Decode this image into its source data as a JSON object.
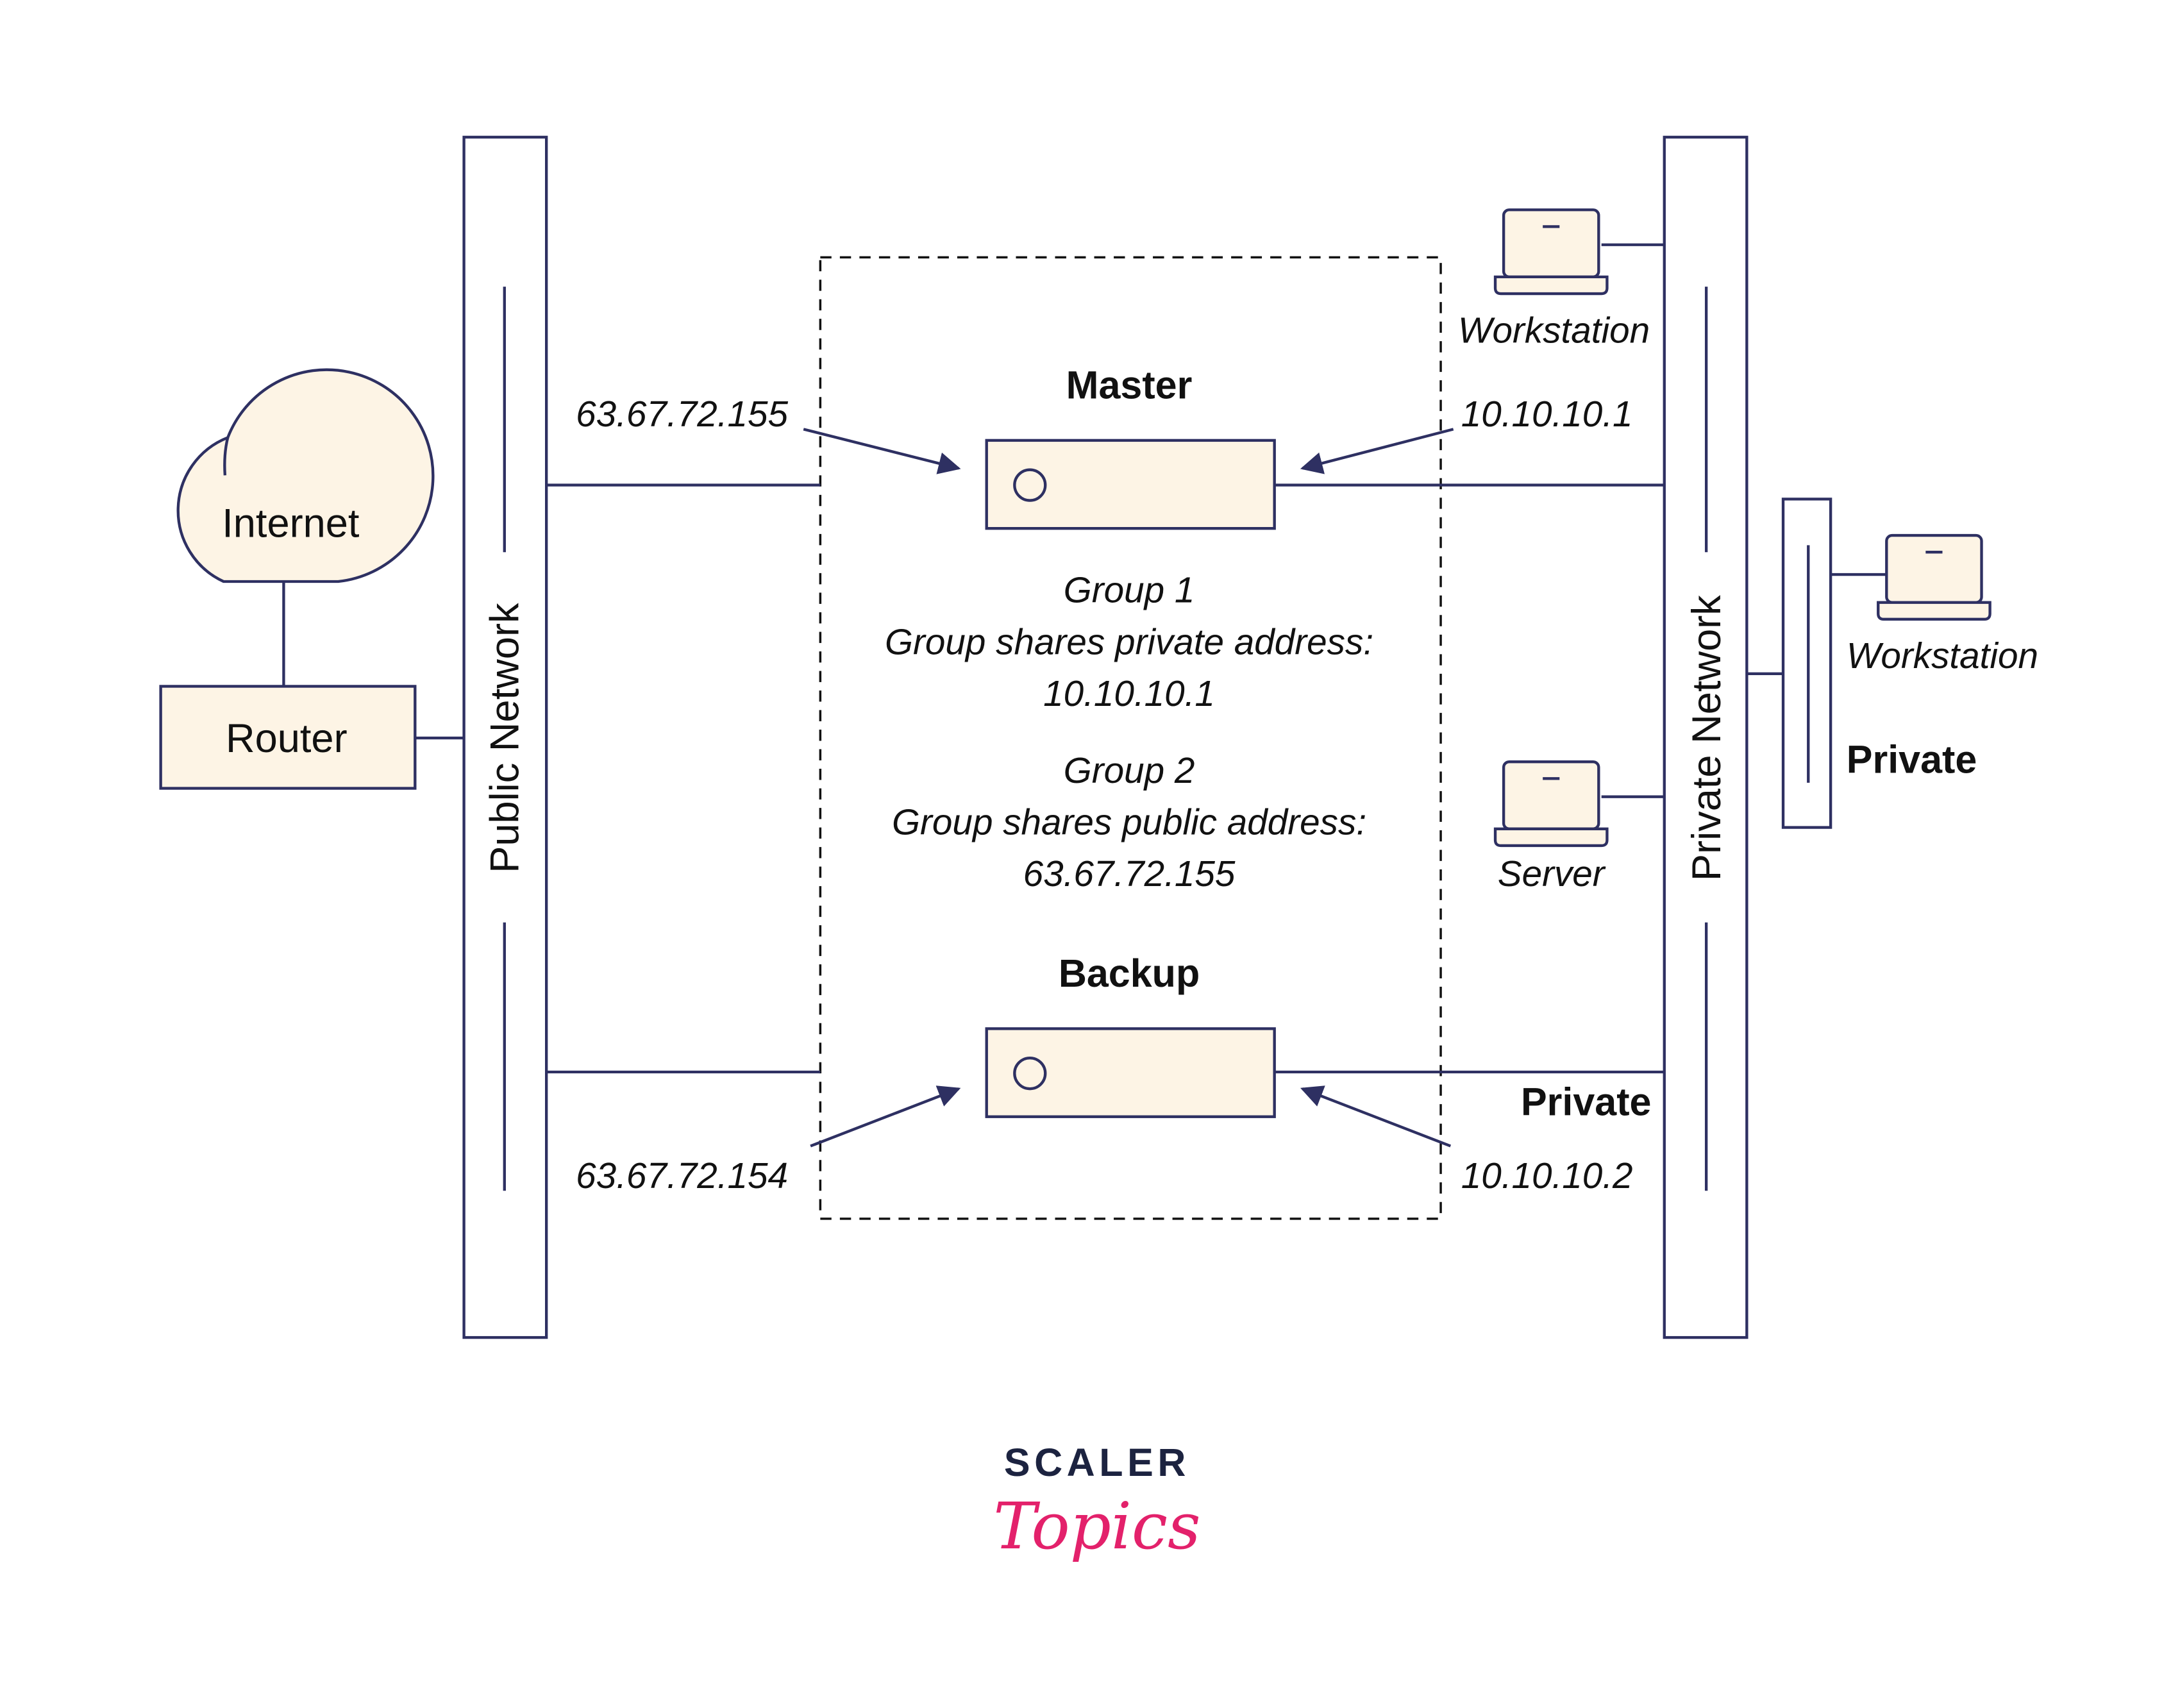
{
  "colors": {
    "stroke": "#2e3062",
    "fill": "#fdf4e5",
    "brand_pink": "#e3216b",
    "brand_dark": "#1c2340"
  },
  "nodes": {
    "internet": "Internet",
    "router": "Router",
    "public_network": "Public Network",
    "private_network": "Private Network",
    "master": "Master",
    "backup": "Backup",
    "workstation_1": "Workstation",
    "workstation_2": "Workstation",
    "server": "Server",
    "private_segment": "Private",
    "private_backup": "Private"
  },
  "addresses": {
    "master_public": "63.67.72.155",
    "master_private": "10.10.10.1",
    "backup_public": "63.67.72.154",
    "backup_private": "10.10.10.2"
  },
  "groups": {
    "g1_title": "Group 1",
    "g1_desc": "Group shares private address:",
    "g1_addr": "10.10.10.1",
    "g2_title": "Group 2",
    "g2_desc": "Group shares public address:",
    "g2_addr": "63.67.72.155"
  },
  "logo": {
    "line1": "SCALER",
    "line2": "Topics"
  }
}
